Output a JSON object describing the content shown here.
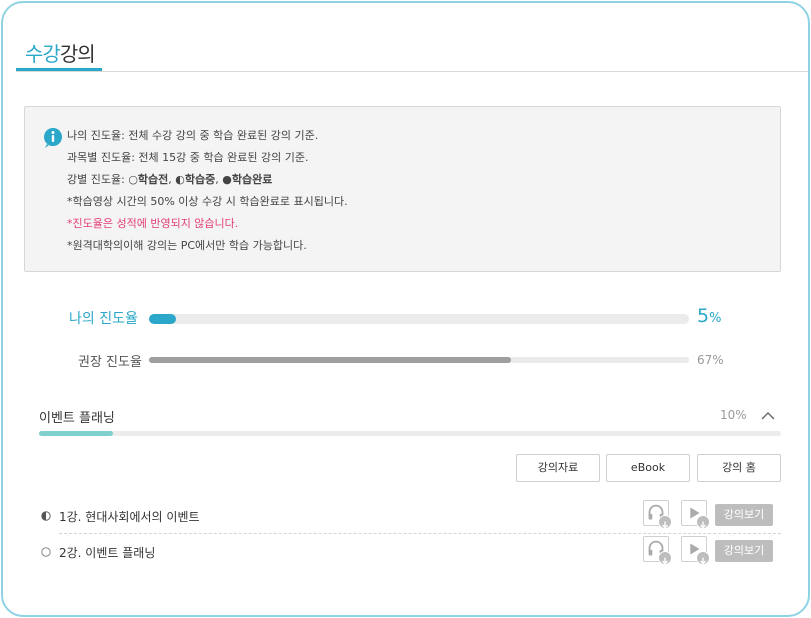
{
  "header": {
    "title_accent": "수강",
    "title_rest": "강의"
  },
  "info": {
    "line1": "나의 진도율: 전체 수강 강의 중 학습 완료된 강의 기준.",
    "line2": "과목별 진도율: 전체 15강 중 학습 완료된 강의 기준.",
    "line3_prefix": "강별 진도율: ",
    "legend_before": "○학습전",
    "legend_sep1": ", ",
    "legend_during": "◐학습중",
    "legend_sep2": ", ",
    "legend_done": "●학습완료",
    "line4": "*학습영상 시간의 50% 이상 수강 시 학습완료로 표시됩니다.",
    "line5": "*진도율은 성적에 반영되지 않습니다.",
    "line6": "*원격대학의이해 강의는 PC에서만 학습 가능합니다."
  },
  "progress": {
    "my_label": "나의 진도율",
    "my_value": 5,
    "my_number": "5",
    "my_unit": "%",
    "rec_label": "권장 진도율",
    "rec_value": 67,
    "rec_text": "67%"
  },
  "event": {
    "title": "이벤트 플래닝",
    "percent_text": "10%",
    "percent_value": 10
  },
  "buttons": {
    "materials": "강의자료",
    "ebook": "eBook",
    "home": "강의 홈"
  },
  "lectures": [
    {
      "title": "1강. 현대사회에서의 이벤트",
      "status": "in-progress",
      "view": "강의보기"
    },
    {
      "title": "2강. 이벤트 플래닝",
      "status": "not-started",
      "view": "강의보기"
    }
  ],
  "colors": {
    "accent": "#2aa7c9",
    "frame_border": "#8fd3e3",
    "my_fill": "#2aa7c9",
    "rec_fill": "#9e9e9e",
    "event_fill": "#7fd0cc",
    "pink_note": "#e23e7a"
  },
  "icons": [
    "info-icon",
    "chevron-up-icon",
    "headphones-icon",
    "play-icon",
    "download-icon",
    "half-circle-icon",
    "empty-circle-icon"
  ]
}
